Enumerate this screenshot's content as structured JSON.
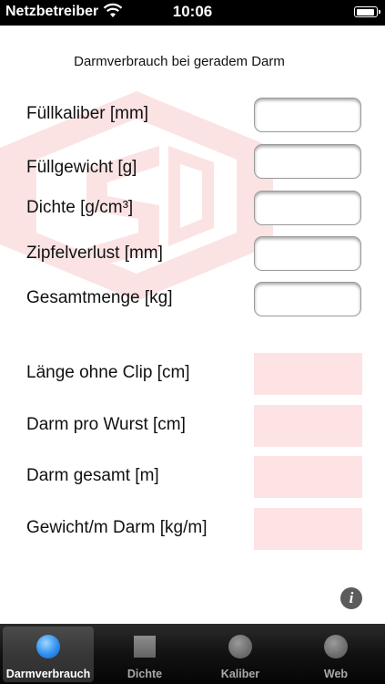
{
  "status_bar": {
    "carrier": "Netzbetreiber",
    "time": "10:06"
  },
  "header": {
    "title": "Darmverbrauch bei geradem Darm"
  },
  "inputs": [
    {
      "label": "Füllkaliber [mm]",
      "value": ""
    },
    {
      "label": "Füllgewicht [g]",
      "value": ""
    },
    {
      "label": "Dichte [g/cm³]",
      "value": ""
    },
    {
      "label": "Zipfelverlust [mm]",
      "value": ""
    },
    {
      "label": "Gesamtmenge [kg]",
      "value": ""
    }
  ],
  "outputs": [
    {
      "label": "Länge ohne Clip [cm]",
      "value": ""
    },
    {
      "label": "Darm pro Wurst [cm]",
      "value": ""
    },
    {
      "label": "Darm gesamt [m]",
      "value": ""
    },
    {
      "label": "Gewicht/m Darm [kg/m]",
      "value": ""
    }
  ],
  "info_button": {
    "icon": "info-icon",
    "glyph": "i"
  },
  "tab_bar": {
    "tabs": [
      {
        "label": "Darmverbrauch",
        "icon": "blue-circle-icon",
        "active": true
      },
      {
        "label": "Dichte",
        "icon": "square-icon",
        "active": false
      },
      {
        "label": "Kaliber",
        "icon": "circle-icon",
        "active": false
      },
      {
        "label": "Web",
        "icon": "circle-icon",
        "active": false
      }
    ]
  },
  "colors": {
    "output_background": "#fde3e4",
    "watermark": "#f7c9cb",
    "tab_active_label": "#ffffff",
    "tab_inactive_label": "#a9a9a9"
  }
}
